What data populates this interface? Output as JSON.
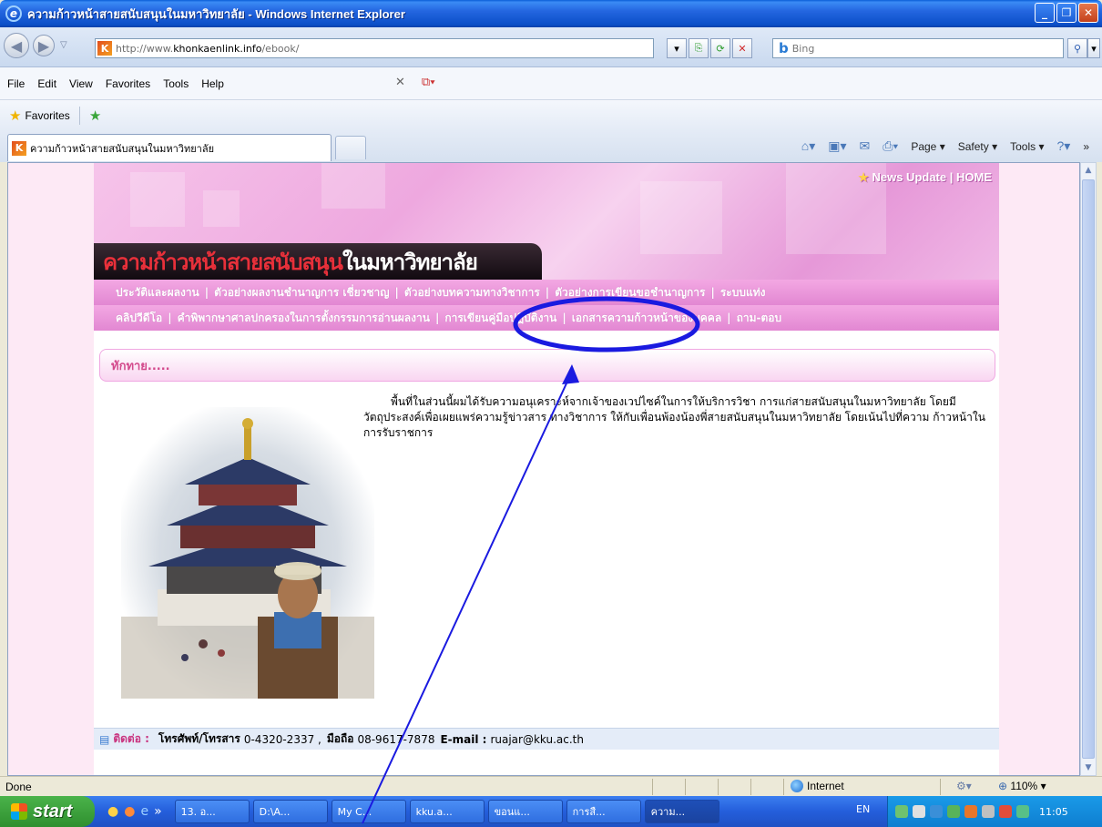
{
  "window": {
    "title": "ความก้าวหน้าสายสนับสนุนในมหาวิทยาลัย - Windows Internet Explorer",
    "minimize_icon": "minimize-icon",
    "maximize_icon": "maximize-icon",
    "close_icon": "close-icon"
  },
  "address": {
    "url_prefix": "http://www.",
    "url_host": "khonkaenlink.info",
    "url_path": "/ebook/",
    "search_placeholder": "Bing",
    "search_brand": "b"
  },
  "menu": {
    "items": [
      "File",
      "Edit",
      "View",
      "Favorites",
      "Tools",
      "Help"
    ]
  },
  "favorites": {
    "label": "Favorites"
  },
  "tab": {
    "title": "ความก้าวหน้าสายสนับสนุนในมหาวิทยาลัย",
    "favicon_letter": "K"
  },
  "commandbar": {
    "page": "Page ▾",
    "safety": "Safety ▾",
    "tools": "Tools ▾",
    "more": "»"
  },
  "site": {
    "news_update": "News Update",
    "home": "HOME",
    "title_part1": "ความก้าวหน้า",
    "title_part2": "สายสนับสนุน",
    "title_part3": "ในมหาวิทยาลัย",
    "nav_row1": [
      "ประวัติและผลงาน",
      "ตัวอย่างผลงานชำนาญการ เชี่ยวชาญ",
      "ตัวอย่างบทความทางวิชาการ",
      "ตัวอย่างการเขียนขอชำนาญการ",
      "ระบบแท่ง"
    ],
    "nav_row2": [
      "คลิปวีดีโอ",
      "คำพิพากษาศาลปกครองในการตั้งกรรมการอ่านผลงาน",
      "การเขียนคู่มือปฏิบัติงาน",
      "เอกสารความก้าวหน้าของบุคคล",
      "ถาม-ตอบ"
    ],
    "section_title": "ทักทาย.....",
    "intro": "พื้นที่ในส่วนนี้ผมได้รับความอนุเคราะห์จากเจ้าของเวปไซค์ในการให้บริการวิชา การแก่สายสนับสนุนในมหาวิทยาลัย โดยมีวัตถุประสงค์เพื่อเผยแพร่ความรู้ข่าวสาร ทางวิชาการ ให้กับเพื่อนพ้องน้องพี่สายสนับสนุนในมหาวิทยาลัย โดยเน้นไปที่ความ ก้าวหน้าในการรับราชการ",
    "footer_label": "ติดต่อ :",
    "footer_phone_label": "โทรศัพท์/โทรสาร",
    "footer_phone": "0-4320-2337 ,",
    "footer_mobile_label": "มือถือ",
    "footer_mobile": "08-9617-7878",
    "footer_email_label": "E-mail :",
    "footer_email": "ruajar@kku.ac.th"
  },
  "status": {
    "text": "Done",
    "zone": "Internet",
    "zoom": "110%"
  },
  "taskbar": {
    "start": "start",
    "tasks": [
      "13. อ...",
      "D:\\A...",
      "My C...",
      "kku.a...",
      "ขอนแ...",
      "การสื...",
      "ความ..."
    ],
    "lang": "EN",
    "clock": "11:05"
  },
  "colors": {
    "annotation": "#1a1ae0",
    "nav_pink": "#e287d2",
    "title_red": "#e8303a"
  }
}
